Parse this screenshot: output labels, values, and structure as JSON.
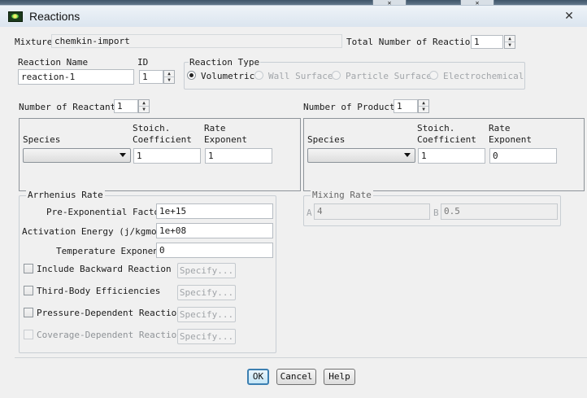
{
  "window": {
    "title": "Reactions",
    "close_glyph": "✕"
  },
  "background_buttons": [
    "✕",
    "✕"
  ],
  "mixture": {
    "label": "Mixture",
    "value": "chemkin-import"
  },
  "total_reactions": {
    "label": "Total Number of Reactions",
    "value": "1"
  },
  "reaction_name": {
    "label": "Reaction Name",
    "value": "reaction-1"
  },
  "reaction_id": {
    "label": "ID",
    "value": "1"
  },
  "reaction_type": {
    "label": "Reaction Type",
    "options": [
      "Volumetric",
      "Wall Surface",
      "Particle Surface",
      "Electrochemical"
    ],
    "selected": "Volumetric"
  },
  "reactants": {
    "count_label": "Number of Reactants",
    "count": "1",
    "species_header": "Species",
    "stoich_header_1": "Stoich.",
    "stoich_header_2": "Coefficient",
    "rate_header_1": "Rate",
    "rate_header_2": "Exponent",
    "stoich_value": "1",
    "rate_value": "1"
  },
  "products": {
    "count_label": "Number of Products",
    "count": "1",
    "species_header": "Species",
    "stoich_header_1": "Stoich.",
    "stoich_header_2": "Coefficient",
    "rate_header_1": "Rate",
    "rate_header_2": "Exponent",
    "stoich_value": "1",
    "rate_value": "0"
  },
  "arrhenius": {
    "title": "Arrhenius Rate",
    "pre_exp_label": "Pre-Exponential Factor",
    "pre_exp_value": "1e+15",
    "activation_label": "Activation Energy (j/kgmol)",
    "activation_value": "1e+08",
    "temp_exp_label": "Temperature Exponent",
    "temp_exp_value": "0"
  },
  "options": [
    {
      "label": "Include Backward Reaction",
      "checked": false,
      "enabled": true
    },
    {
      "label": "Third-Body Efficiencies",
      "checked": false,
      "enabled": true
    },
    {
      "label": "Pressure-Dependent Reaction",
      "checked": false,
      "enabled": true
    },
    {
      "label": "Coverage-Dependent Reaction",
      "checked": false,
      "enabled": false
    }
  ],
  "specify_label": "Specify...",
  "mixing_rate": {
    "title": "Mixing Rate",
    "a_label": "A",
    "a_value": "4",
    "b_label": "B",
    "b_value": "0.5"
  },
  "buttons": {
    "ok": "OK",
    "cancel": "Cancel",
    "help": "Help"
  }
}
